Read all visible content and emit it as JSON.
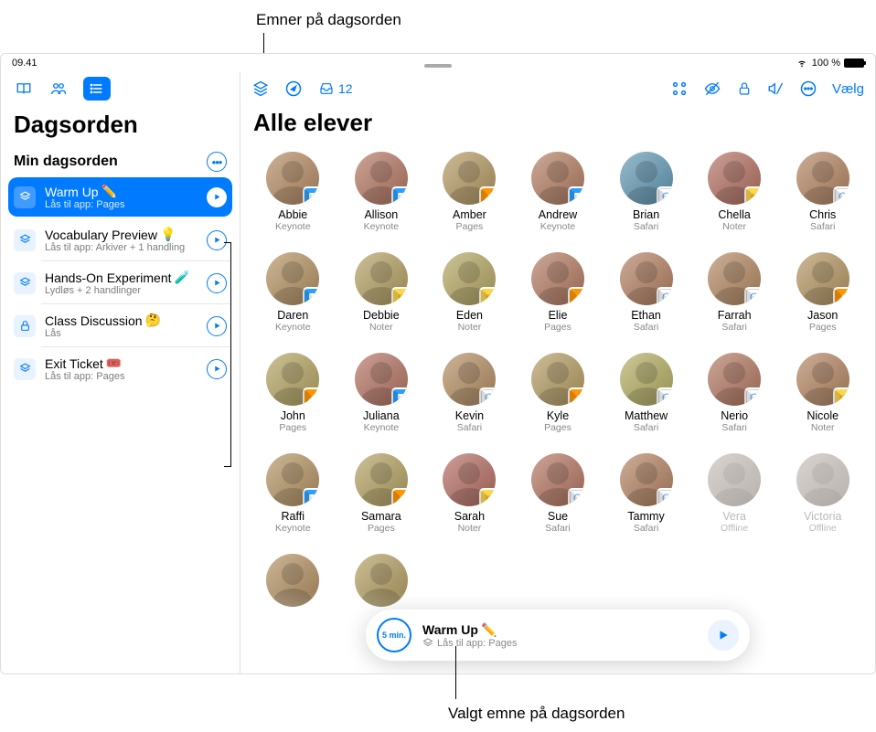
{
  "colors": {
    "accent": "#007aff"
  },
  "callouts": {
    "top": "Emner på dagsorden",
    "bottom": "Valgt emne på dagsorden"
  },
  "status": {
    "time": "09.41",
    "battery": "100 %"
  },
  "sidebar": {
    "title": "Dagsorden",
    "agenda_header": "Min dagsorden",
    "items": [
      {
        "icon": "stack",
        "title": "Warm Up",
        "emoji": "✏️",
        "sub": "Lås til app: Pages",
        "selected": true
      },
      {
        "icon": "stack",
        "title": "Vocabulary Preview",
        "emoji": "💡",
        "sub": "Lås til app: Arkiver + 1 handling",
        "selected": false
      },
      {
        "icon": "stack",
        "title": "Hands-On Experiment",
        "emoji": "🧪",
        "sub": "Lydløs + 2 handlinger",
        "selected": false
      },
      {
        "icon": "lock",
        "title": "Class Discussion",
        "emoji": "🤔",
        "sub": "Lås",
        "selected": false
      },
      {
        "icon": "stack",
        "title": "Exit Ticket",
        "emoji": "🎟️",
        "sub": "Lås til app: Pages",
        "selected": false
      }
    ]
  },
  "main": {
    "title": "Alle elever",
    "inbox_count": "12",
    "select_label": "Vælg"
  },
  "students": [
    {
      "name": "Abbie",
      "app": "Keynote",
      "badge": "keynote"
    },
    {
      "name": "Allison",
      "app": "Keynote",
      "badge": "keynote"
    },
    {
      "name": "Amber",
      "app": "Pages",
      "badge": "pages"
    },
    {
      "name": "Andrew",
      "app": "Keynote",
      "badge": "keynote"
    },
    {
      "name": "Brian",
      "app": "Safari",
      "badge": "safari"
    },
    {
      "name": "Chella",
      "app": "Noter",
      "badge": "noter"
    },
    {
      "name": "Chris",
      "app": "Safari",
      "badge": "safari"
    },
    {
      "name": "Daren",
      "app": "Keynote",
      "badge": "keynote"
    },
    {
      "name": "Debbie",
      "app": "Noter",
      "badge": "noter"
    },
    {
      "name": "Eden",
      "app": "Noter",
      "badge": "noter"
    },
    {
      "name": "Elie",
      "app": "Pages",
      "badge": "pages"
    },
    {
      "name": "Ethan",
      "app": "Safari",
      "badge": "safari"
    },
    {
      "name": "Farrah",
      "app": "Safari",
      "badge": "safari"
    },
    {
      "name": "Jason",
      "app": "Pages",
      "badge": "pages"
    },
    {
      "name": "John",
      "app": "Pages",
      "badge": "pages"
    },
    {
      "name": "Juliana",
      "app": "Keynote",
      "badge": "keynote"
    },
    {
      "name": "Kevin",
      "app": "Safari",
      "badge": "safari"
    },
    {
      "name": "Kyle",
      "app": "Pages",
      "badge": "pages"
    },
    {
      "name": "Matthew",
      "app": "Safari",
      "badge": "safari"
    },
    {
      "name": "Nerio",
      "app": "Safari",
      "badge": "safari"
    },
    {
      "name": "Nicole",
      "app": "Noter",
      "badge": "noter"
    },
    {
      "name": "Raffi",
      "app": "Keynote",
      "badge": "keynote"
    },
    {
      "name": "Samara",
      "app": "Pages",
      "badge": "pages"
    },
    {
      "name": "Sarah",
      "app": "Noter",
      "badge": "noter"
    },
    {
      "name": "Sue",
      "app": "Safari",
      "badge": "safari"
    },
    {
      "name": "Tammy",
      "app": "Safari",
      "badge": "safari"
    },
    {
      "name": "Vera",
      "app": "Offline",
      "badge": "",
      "offline": true
    },
    {
      "name": "Victoria",
      "app": "Offline",
      "badge": "",
      "offline": true
    },
    {
      "name": "",
      "app": "",
      "badge": ""
    },
    {
      "name": "",
      "app": "",
      "badge": ""
    }
  ],
  "bottom_card": {
    "timer": "5 min.",
    "title": "Warm Up",
    "emoji": "✏️",
    "sub": "Lås til app: Pages"
  }
}
